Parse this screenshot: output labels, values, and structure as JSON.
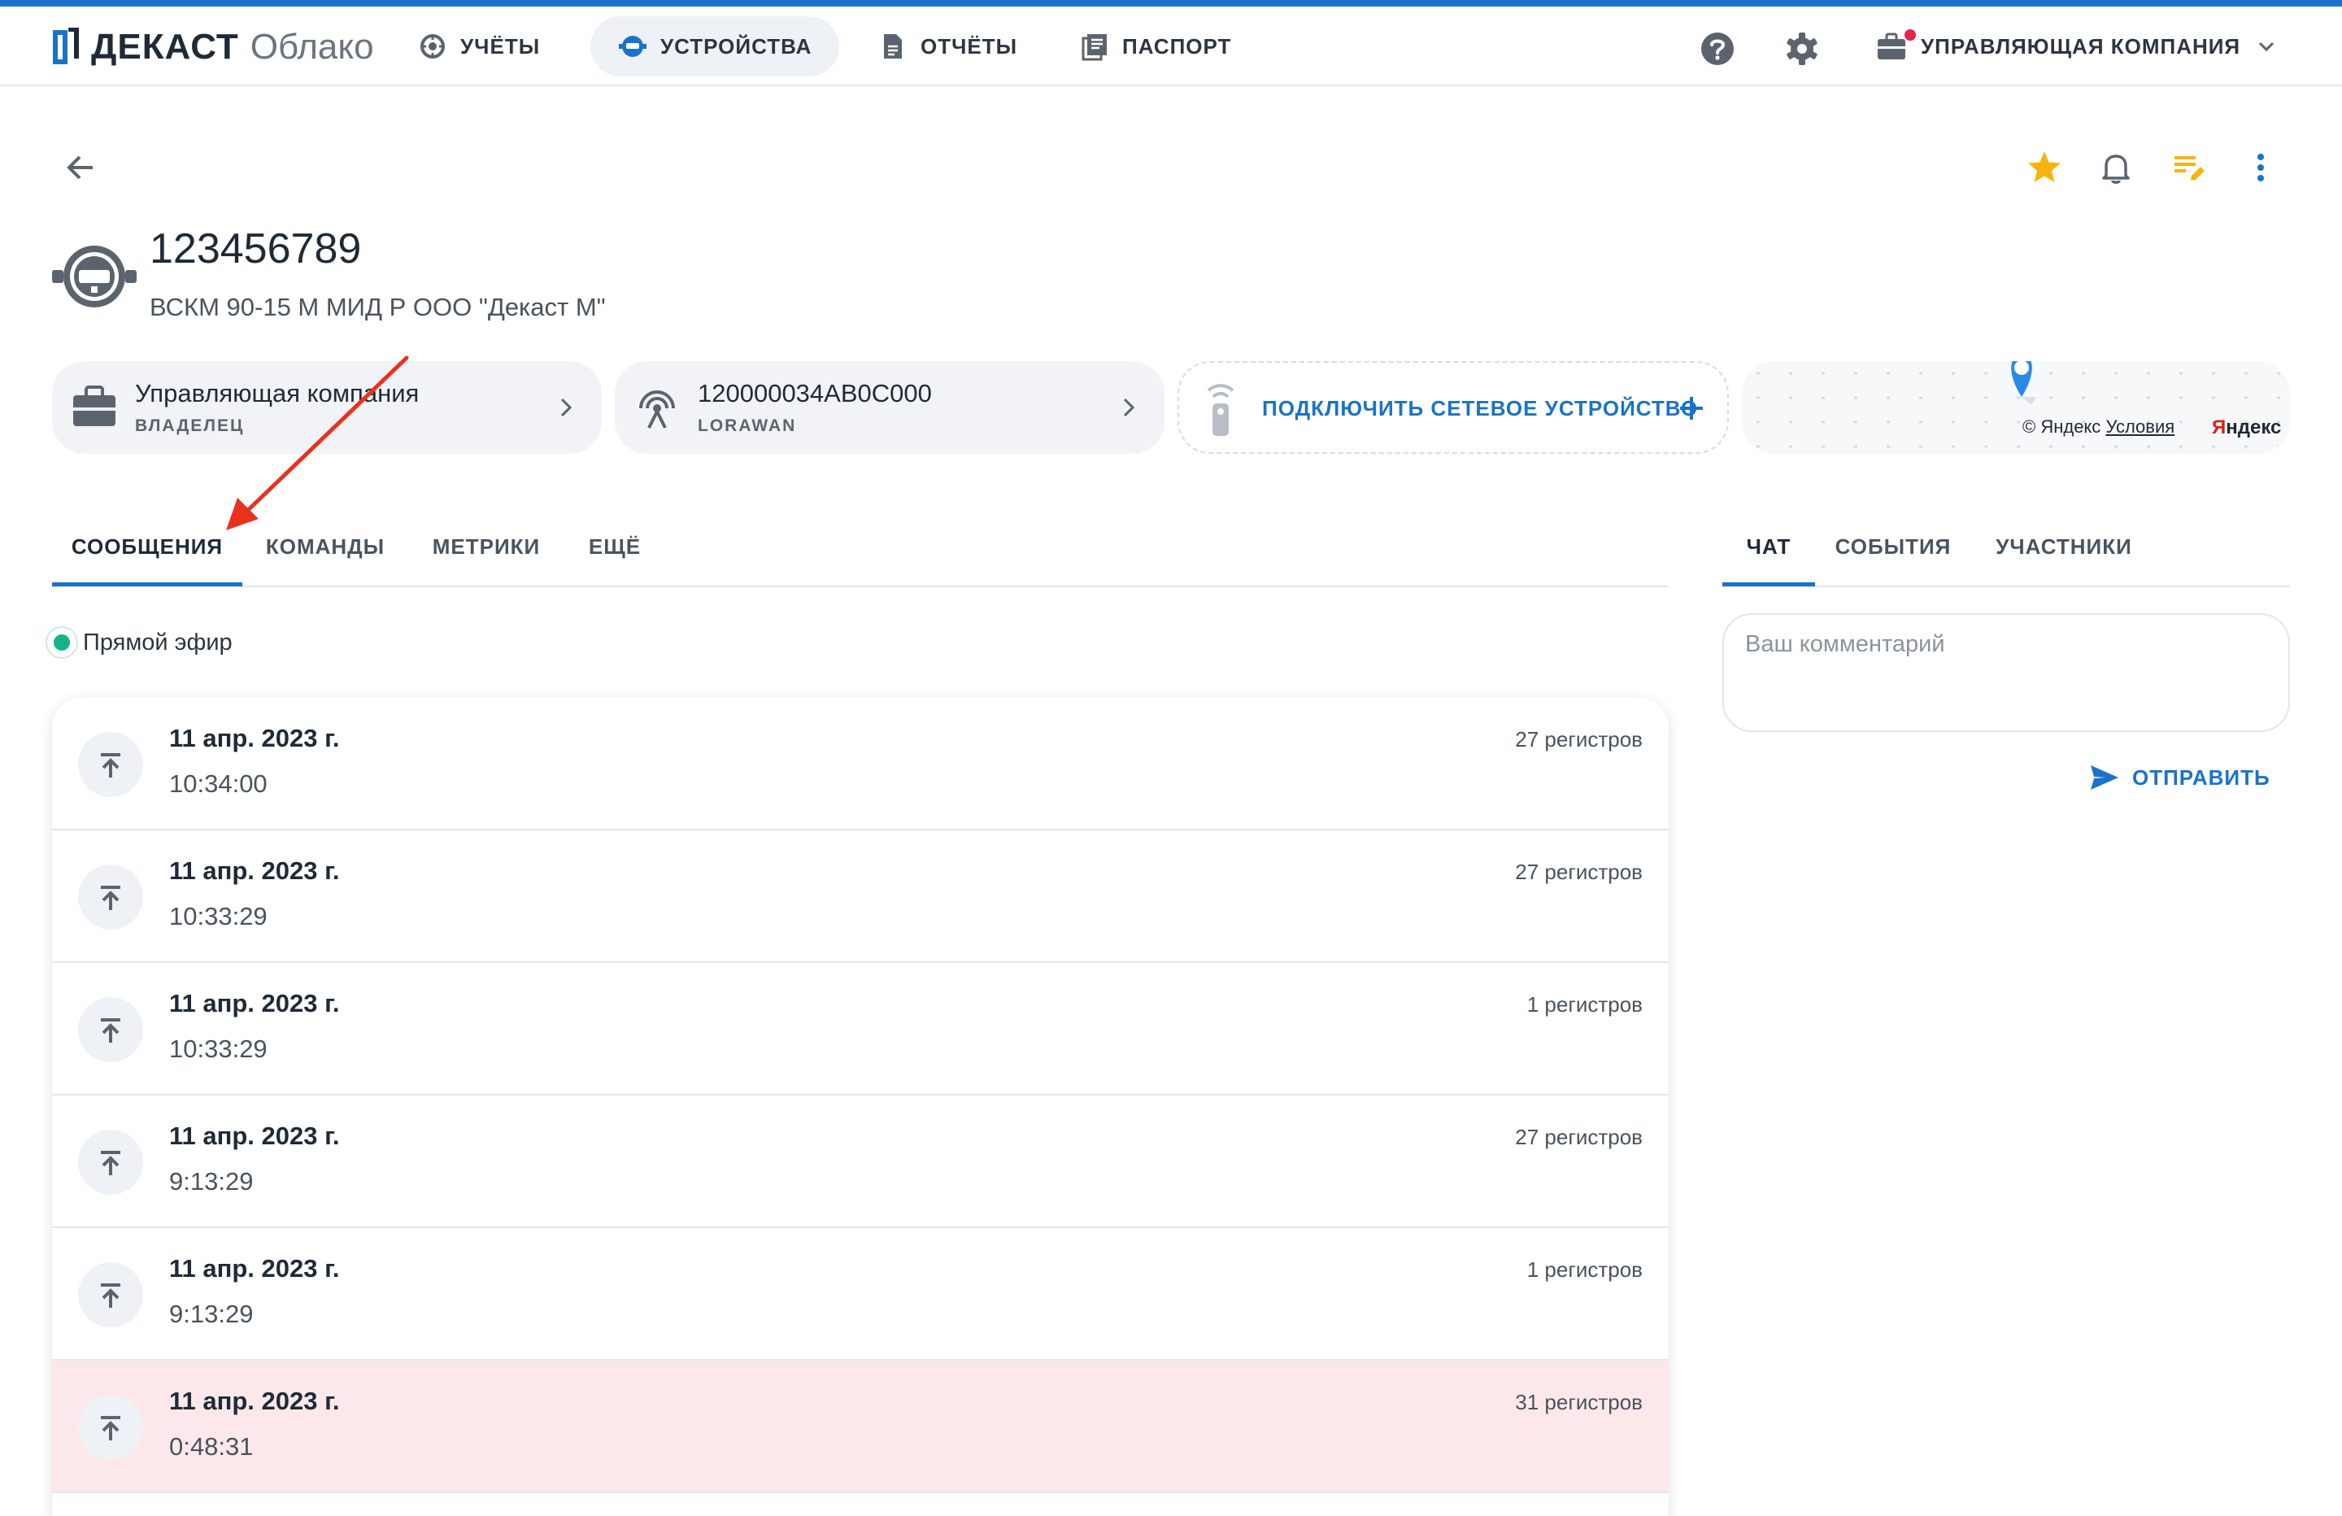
{
  "app": {
    "logo_brand": "ДЕКАСТ",
    "logo_sub": "Облако"
  },
  "nav": [
    {
      "label": "УЧЁТЫ",
      "icon": "meter-icon"
    },
    {
      "label": "УСТРОЙСТВА",
      "icon": "device-icon",
      "active": true
    },
    {
      "label": "ОТЧЁТЫ",
      "icon": "document-icon"
    },
    {
      "label": "ПАСПОРТ",
      "icon": "passport-icon"
    }
  ],
  "topbar": {
    "help_icon": "help-icon",
    "settings_icon": "gear-icon",
    "company_label": "УПРАВЛЯЮЩАЯ КОМПАНИЯ"
  },
  "device": {
    "title": "123456789",
    "subtitle": "ВСКМ 90-15 М МИД Р ООО \"Декаст М\""
  },
  "cards": {
    "owner": {
      "title": "Управляющая компания",
      "caption": "ВЛАДЕЛЕЦ"
    },
    "network": {
      "title": "120000034AB0C000",
      "caption": "LORAWAN"
    },
    "connect_label": "ПОДКЛЮЧИТЬ СЕТЕВОЕ УСТРОЙСТВО",
    "map": {
      "copyright": "© Яндекс",
      "terms": "Условия",
      "brand_red": "Я",
      "brand_rest": "ндекс"
    }
  },
  "tabs": {
    "messages": "СООБЩЕНИЯ",
    "commands": "КОМАНДЫ",
    "metrics": "МЕТРИКИ",
    "more": "ЕЩЁ"
  },
  "side_tabs": {
    "chat": "ЧАТ",
    "events": "СОБЫТИЯ",
    "members": "УЧАСТНИКИ"
  },
  "live": {
    "label": "Прямой эфир",
    "enabled": true
  },
  "messages": [
    {
      "date": "11 апр. 2023 г.",
      "time": "10:34:00",
      "registers": "27 регистров"
    },
    {
      "date": "11 апр. 2023 г.",
      "time": "10:33:29",
      "registers": "27 регистров"
    },
    {
      "date": "11 апр. 2023 г.",
      "time": "10:33:29",
      "registers": "1 регистров"
    },
    {
      "date": "11 апр. 2023 г.",
      "time": "9:13:29",
      "registers": "27 регистров"
    },
    {
      "date": "11 апр. 2023 г.",
      "time": "9:13:29",
      "registers": "1 регистров"
    },
    {
      "date": "11 апр. 2023 г.",
      "time": "0:48:31",
      "registers": "31 регистров",
      "highlight": true
    }
  ],
  "chat": {
    "placeholder": "Ваш комментарий",
    "send_label": "ОТПРАВИТЬ"
  },
  "colors": {
    "accent": "#1a73c8",
    "live": "#15b38a",
    "star": "#f5b50f",
    "alert_row": "#fce8ea",
    "annotation": "#e8321e"
  }
}
